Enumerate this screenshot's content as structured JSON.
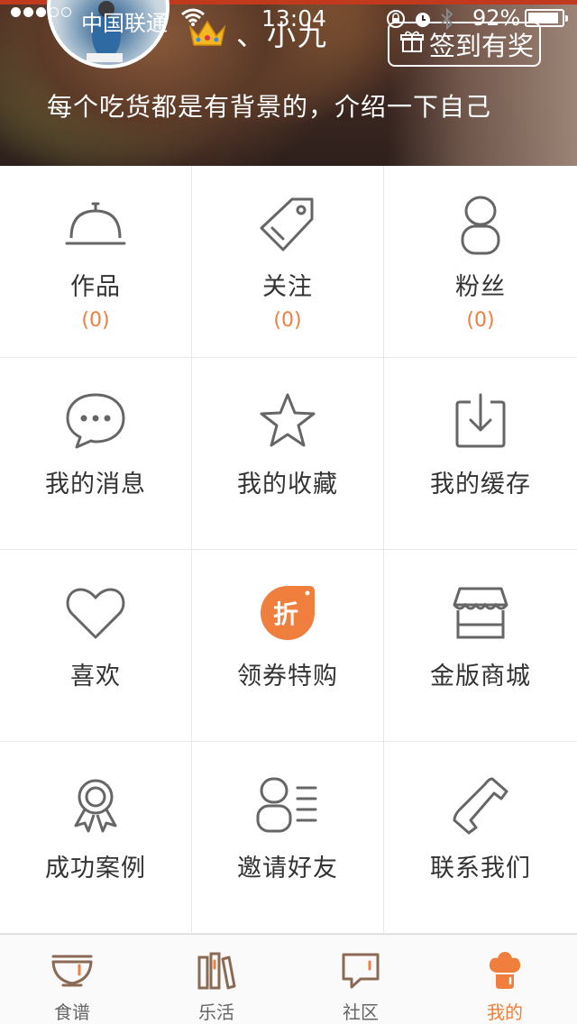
{
  "status_bar": {
    "carrier": "中国联通",
    "time": "13:04",
    "battery_percent": "92%",
    "battery_level": 0.92,
    "signal_bars_filled": 3,
    "signal_bars_total": 5
  },
  "profile": {
    "username": "、小九",
    "bio": "每个吃货都是有背景的，介绍一下自己",
    "signin_label": "签到有奖",
    "avatar_icon": "avatar-photo",
    "badge_icon": "crown-icon"
  },
  "grid": {
    "items": [
      {
        "label": "作品",
        "count": "(0)",
        "icon": "food-cloche-icon"
      },
      {
        "label": "关注",
        "count": "(0)",
        "icon": "tag-icon"
      },
      {
        "label": "粉丝",
        "count": "(0)",
        "icon": "person-icon"
      },
      {
        "label": "我的消息",
        "icon": "chat-bubble-icon"
      },
      {
        "label": "我的收藏",
        "icon": "star-icon"
      },
      {
        "label": "我的缓存",
        "icon": "download-icon"
      },
      {
        "label": "喜欢",
        "icon": "heart-icon"
      },
      {
        "label": "领券特购",
        "icon": "discount-badge-icon",
        "badge_text": "折"
      },
      {
        "label": "金版商城",
        "icon": "shop-icon"
      },
      {
        "label": "成功案例",
        "icon": "award-ribbon-icon"
      },
      {
        "label": "邀请好友",
        "icon": "contacts-icon"
      },
      {
        "label": "联系我们",
        "icon": "phone-icon"
      }
    ]
  },
  "tabbar": {
    "tabs": [
      {
        "label": "食谱",
        "icon": "bowl-icon",
        "active": false
      },
      {
        "label": "乐活",
        "icon": "books-icon",
        "active": false
      },
      {
        "label": "社区",
        "icon": "speech-bubble-icon",
        "active": false
      },
      {
        "label": "我的",
        "icon": "chef-hat-icon",
        "active": true
      }
    ]
  },
  "colors": {
    "accent": "#f07e3c",
    "icon_gray": "#666666",
    "divider": "#e8e8e8"
  }
}
